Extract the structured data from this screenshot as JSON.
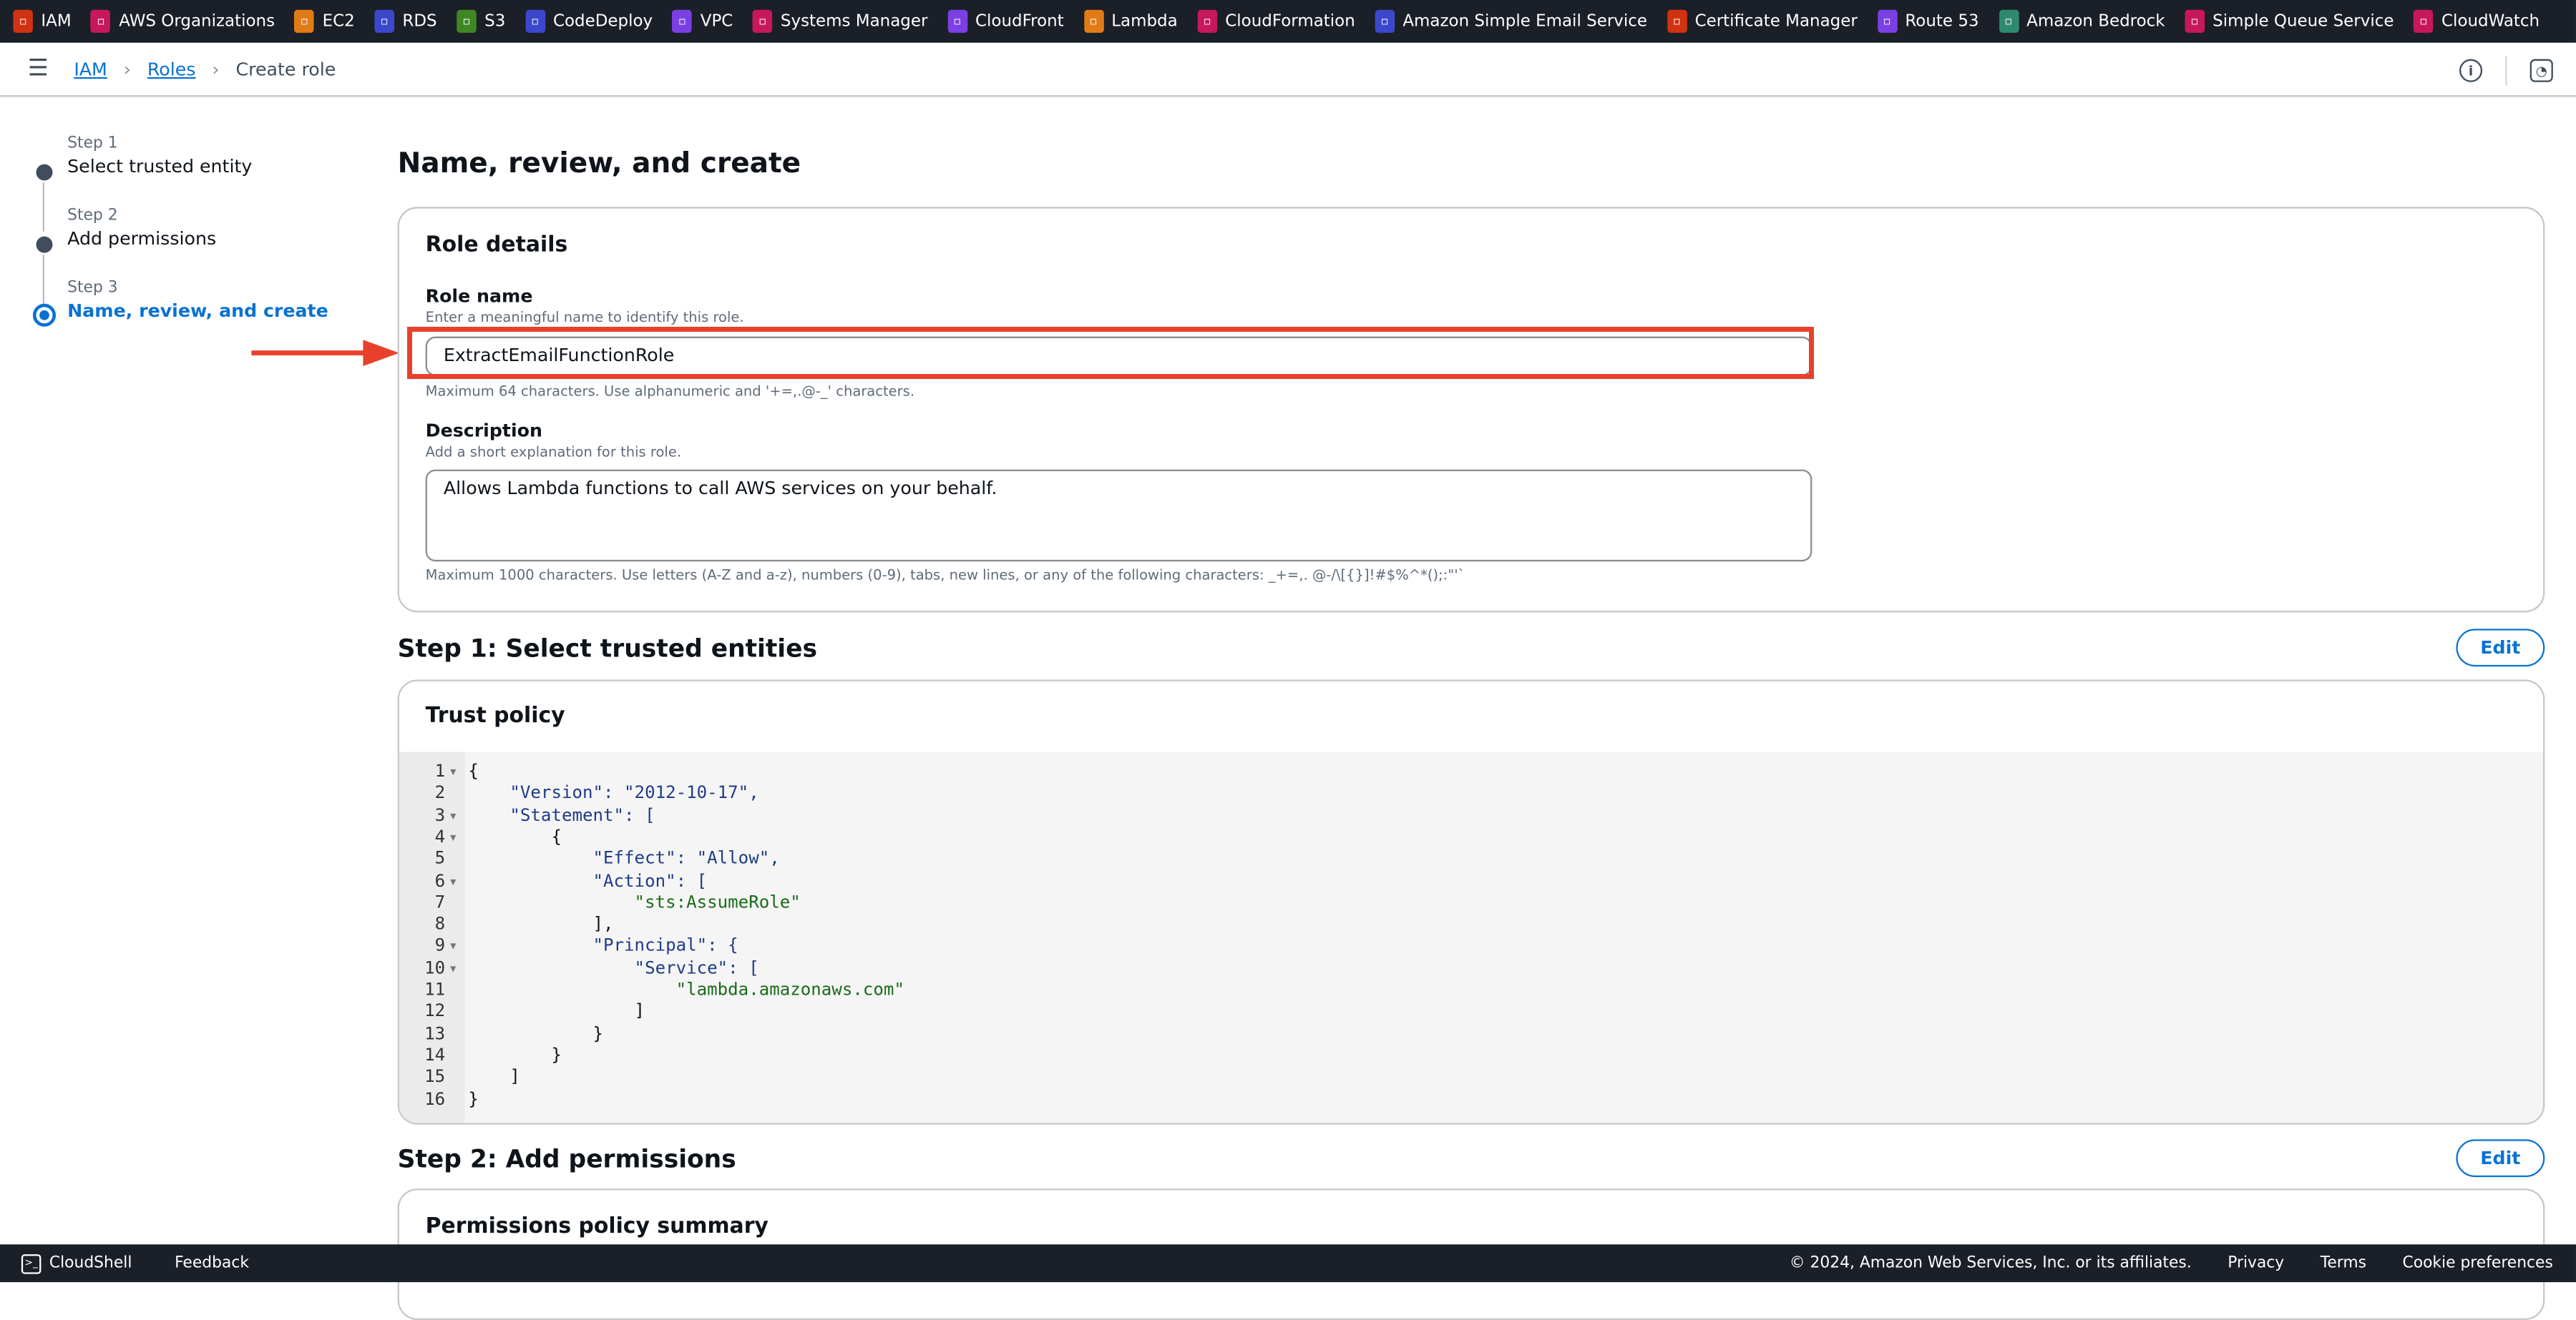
{
  "services": [
    {
      "label": "IAM",
      "color": "#d13212",
      "icon": "iam-icon"
    },
    {
      "label": "AWS Organizations",
      "color": "#c7185b",
      "icon": "organizations-icon"
    },
    {
      "label": "EC2",
      "color": "#e07b18",
      "icon": "ec2-icon"
    },
    {
      "label": "RDS",
      "color": "#3b48cc",
      "icon": "rds-icon"
    },
    {
      "label": "S3",
      "color": "#3f8624",
      "icon": "s3-icon"
    },
    {
      "label": "CodeDeploy",
      "color": "#3b48cc",
      "icon": "codedeploy-icon"
    },
    {
      "label": "VPC",
      "color": "#7b3fe4",
      "icon": "vpc-icon"
    },
    {
      "label": "Systems Manager",
      "color": "#c7185b",
      "icon": "systems-manager-icon"
    },
    {
      "label": "CloudFront",
      "color": "#7b3fe4",
      "icon": "cloudfront-icon"
    },
    {
      "label": "Lambda",
      "color": "#e07b18",
      "icon": "lambda-icon"
    },
    {
      "label": "CloudFormation",
      "color": "#c7185b",
      "icon": "cloudformation-icon"
    },
    {
      "label": "Amazon Simple Email Service",
      "color": "#3b48cc",
      "icon": "ses-icon"
    },
    {
      "label": "Certificate Manager",
      "color": "#d13212",
      "icon": "certificate-manager-icon"
    },
    {
      "label": "Route 53",
      "color": "#7b3fe4",
      "icon": "route53-icon"
    },
    {
      "label": "Amazon Bedrock",
      "color": "#2e8a6e",
      "icon": "bedrock-icon"
    },
    {
      "label": "Simple Queue Service",
      "color": "#c7185b",
      "icon": "sqs-icon"
    },
    {
      "label": "CloudWatch",
      "color": "#c7185b",
      "icon": "cloudwatch-icon"
    }
  ],
  "breadcrumb": {
    "iam": "IAM",
    "roles": "Roles",
    "current": "Create role"
  },
  "steps": [
    {
      "label": "Step 1",
      "name": "Select trusted entity"
    },
    {
      "label": "Step 2",
      "name": "Add permissions"
    },
    {
      "label": "Step 3",
      "name": "Name, review, and create"
    }
  ],
  "page_title": "Name, review, and create",
  "role_details": {
    "title": "Role details",
    "name_label": "Role name",
    "name_desc": "Enter a meaningful name to identify this role.",
    "name_value": "ExtractEmailFunctionRole",
    "name_hint": "Maximum 64 characters. Use alphanumeric and '+=,.@-_' characters.",
    "desc_label": "Description",
    "desc_desc": "Add a short explanation for this role.",
    "desc_value": "Allows Lambda functions to call AWS services on your behalf.",
    "desc_hint": "Maximum 1000 characters. Use letters (A-Z and a-z), numbers (0-9), tabs, new lines, or any of the following characters: _+=,. @-/\\[{}]!#$%^*();:\"'`"
  },
  "step1": {
    "title": "Step 1: Select trusted entities",
    "edit": "Edit",
    "card_title": "Trust policy",
    "code": [
      "{",
      "    \"Version\": \"2012-10-17\",",
      "    \"Statement\": [",
      "        {",
      "            \"Effect\": \"Allow\",",
      "            \"Action\": [",
      "                \"sts:AssumeRole\"",
      "            ],",
      "            \"Principal\": {",
      "                \"Service\": [",
      "                    \"lambda.amazonaws.com\"",
      "                ]",
      "            }",
      "        }",
      "    ]",
      "}"
    ]
  },
  "step2": {
    "title": "Step 2: Add permissions",
    "edit": "Edit",
    "card_title": "Permissions policy summary"
  },
  "footer": {
    "cloudshell": "CloudShell",
    "feedback": "Feedback",
    "copyright": "© 2024, Amazon Web Services, Inc. or its affiliates.",
    "privacy": "Privacy",
    "terms": "Terms",
    "cookies": "Cookie preferences"
  }
}
